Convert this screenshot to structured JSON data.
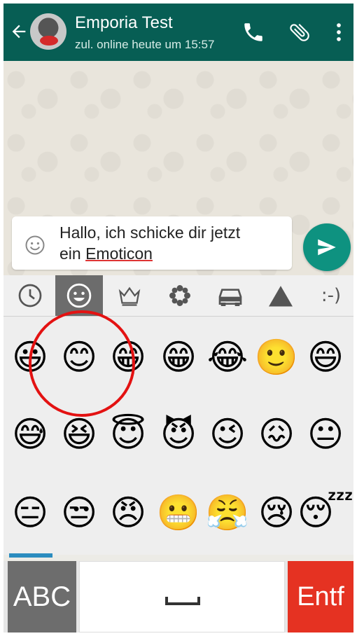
{
  "header": {
    "contact_name": "Emporia Test",
    "last_seen": "zul. online heute um 15:57",
    "icons": [
      "back-arrow-icon",
      "avatar",
      "phone-icon",
      "paperclip-icon",
      "more-vert-icon"
    ]
  },
  "composer": {
    "text_line1": "Hallo, ich schicke dir jetzt",
    "text_line2_prefix": "ein ",
    "text_line2_misspelled": "Emoticon",
    "emoji_button_icon": "smiley-icon",
    "send_icon": "send-icon"
  },
  "emoji_tabs": [
    {
      "icon": "clock-icon"
    },
    {
      "icon": "smiley-icon",
      "active": true
    },
    {
      "icon": "crown-icon"
    },
    {
      "icon": "flower-icon"
    },
    {
      "icon": "car-icon"
    },
    {
      "icon": "triangle-icon"
    },
    {
      "label": ":-)"
    }
  ],
  "emoji_grid": [
    [
      "😃",
      "😊",
      "😁",
      "😁",
      "😂",
      "🙂",
      "😄"
    ],
    [
      "😅",
      "😆",
      "😇",
      "😈",
      "😉",
      "😖",
      "😐"
    ],
    [
      "😑",
      "😒",
      "😠",
      "😬",
      "😤",
      "😢",
      "😴"
    ]
  ],
  "keys": {
    "abc": "ABC",
    "delete": "Entf"
  },
  "colors": {
    "header": "#075e54",
    "send_button": "#0e9280",
    "delete_key": "#e53222",
    "highlight_circle": "#e31212"
  }
}
